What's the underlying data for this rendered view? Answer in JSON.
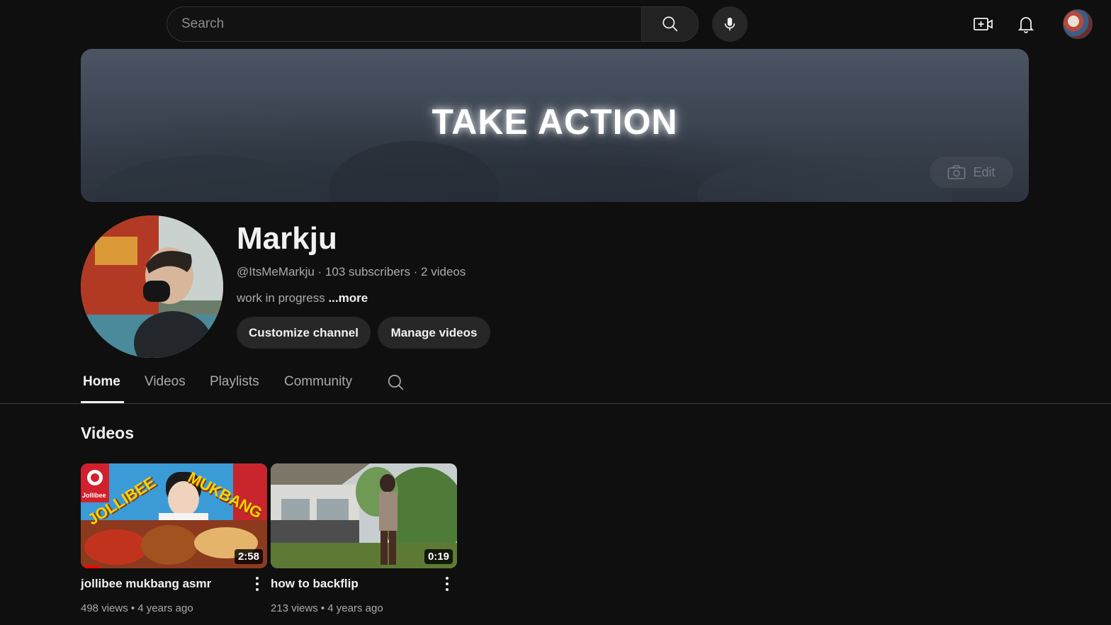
{
  "header": {
    "search_placeholder": "Search",
    "icons": [
      "search-icon",
      "microphone-icon",
      "create-video-icon",
      "notifications-bell-icon",
      "account-avatar"
    ]
  },
  "banner": {
    "title": "TAKE ACTION",
    "edit_label": "Edit"
  },
  "channel": {
    "name": "Markju",
    "meta": "@ItsMeMarkju · 103 subscribers · 2 videos",
    "description": "work in progress",
    "more_label": "...more",
    "customize_label": "Customize channel",
    "manage_label": "Manage videos"
  },
  "tabs": [
    {
      "label": "Home",
      "active": true
    },
    {
      "label": "Videos",
      "active": false
    },
    {
      "label": "Playlists",
      "active": false
    },
    {
      "label": "Community",
      "active": false
    }
  ],
  "section": {
    "title": "Videos"
  },
  "videos": [
    {
      "title": "jollibee mukbang asmr",
      "duration": "2:58",
      "views": "498 views",
      "age": "4 years ago",
      "meta": "498 views • 4 years ago"
    },
    {
      "title": "how to backflip",
      "duration": "0:19",
      "views": "213 views",
      "age": "4 years ago",
      "meta": "213 views • 4 years ago"
    }
  ],
  "thumbnail_text": {
    "brand": "Jollibee",
    "word1": "JOLLIBEE",
    "word2": "MUKBANG"
  },
  "colors": {
    "background": "#0f0f0f",
    "text_primary": "#f1f1f1",
    "text_secondary": "#aaaaaa",
    "pill": "#272727",
    "jollibee_red": "#d3202d"
  }
}
